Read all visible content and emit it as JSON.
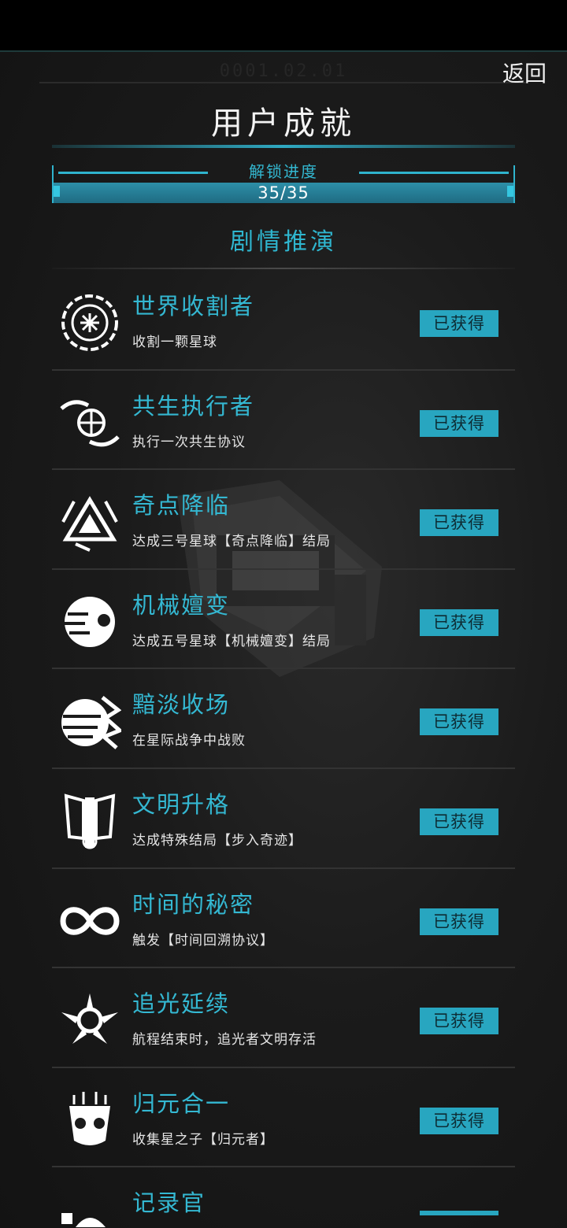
{
  "header": {
    "back_label": "返回",
    "date_watermark": "0001.02.01",
    "title": "用户成就"
  },
  "progress": {
    "label": "解锁进度",
    "text": "35/35",
    "value": 1.0
  },
  "section": {
    "title": "剧情推演"
  },
  "achievements": [
    {
      "name": "世界收割者",
      "desc": "收割一颗星球",
      "status": "已获得",
      "icon": "harvester-emblem-icon"
    },
    {
      "name": "共生执行者",
      "desc": "执行一次共生协议",
      "status": "已获得",
      "icon": "hands-globe-icon"
    },
    {
      "name": "奇点降临",
      "desc": "达成三号星球【奇点降临】结局",
      "status": "已获得",
      "icon": "singularity-triangle-icon"
    },
    {
      "name": "机械嬗变",
      "desc": "达成五号星球【机械嬗变】结局",
      "status": "已获得",
      "icon": "mechanical-eye-icon"
    },
    {
      "name": "黯淡收场",
      "desc": "在星际战争中战败",
      "status": "已获得",
      "icon": "broken-planet-icon"
    },
    {
      "name": "文明升格",
      "desc": "达成特殊结局【步入奇迹】",
      "status": "已获得",
      "icon": "winged-monument-icon"
    },
    {
      "name": "时间的秘密",
      "desc": "触发【时间回溯协议】",
      "status": "已获得",
      "icon": "infinity-icon"
    },
    {
      "name": "追光延续",
      "desc": "航程结束时，追光者文明存活",
      "status": "已获得",
      "icon": "winged-star-icon"
    },
    {
      "name": "归元合一",
      "desc": "收集星之子【归元者】",
      "status": "已获得",
      "icon": "robot-mask-icon"
    },
    {
      "name": "记录官",
      "desc": "",
      "status": "",
      "icon": "recorder-icon"
    }
  ]
}
